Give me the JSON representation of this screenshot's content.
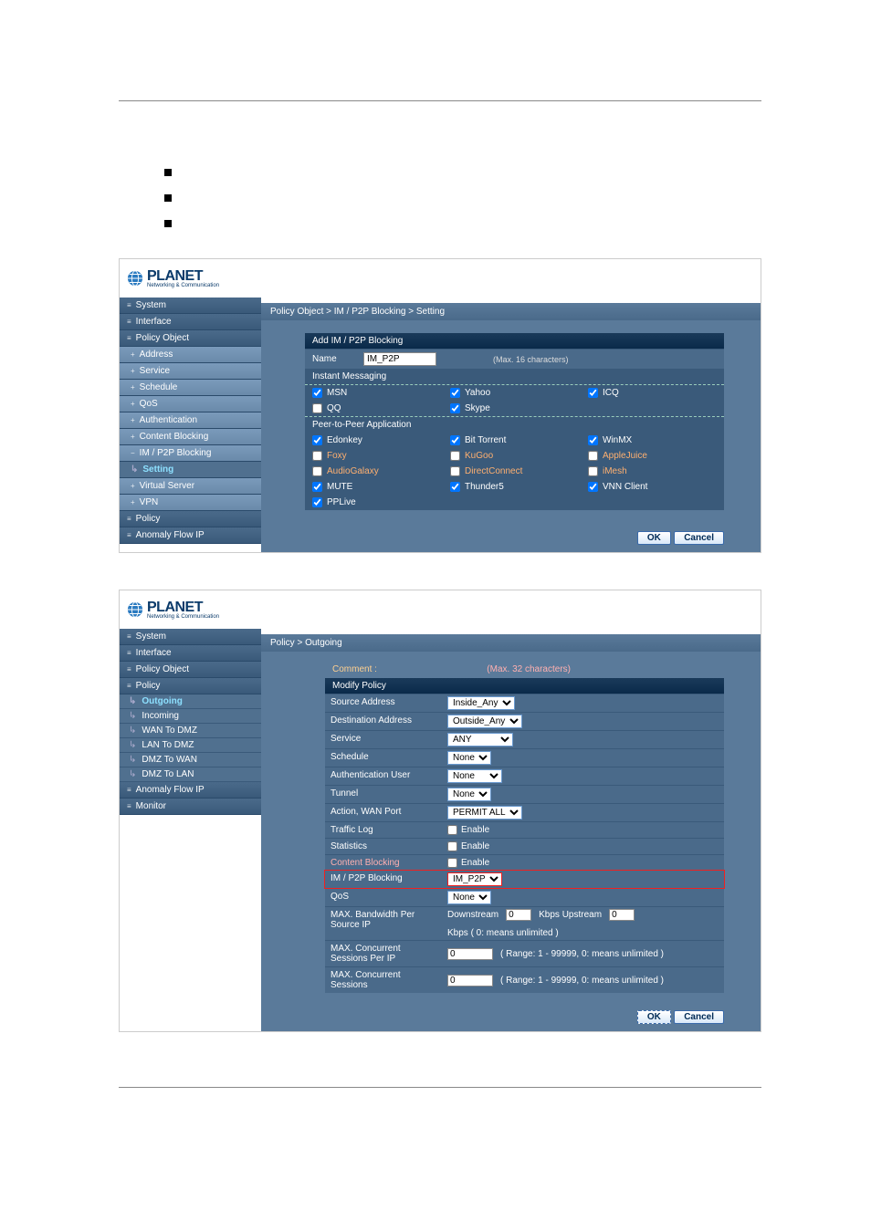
{
  "bullets": [],
  "logo": {
    "brand": "PLANET",
    "tagline": "Networking & Communication"
  },
  "shell1": {
    "breadcrumb": "Policy Object > IM / P2P Blocking > Setting",
    "nav": {
      "system": "System",
      "interface": "Interface",
      "policyObject": "Policy Object",
      "address": "Address",
      "service": "Service",
      "schedule": "Schedule",
      "qos": "QoS",
      "authentication": "Authentication",
      "contentBlocking": "Content Blocking",
      "imP2p": "IM / P2P Blocking",
      "setting": "Setting",
      "virtualServer": "Virtual Server",
      "vpn": "VPN",
      "policy": "Policy",
      "anomaly": "Anomaly Flow IP"
    },
    "panel": {
      "title": "Add IM / P2P Blocking",
      "nameLabel": "Name",
      "nameValue": "IM_P2P",
      "nameHint": "(Max. 16 characters)",
      "imSection": "Instant Messaging",
      "im": {
        "msn": "MSN",
        "yahoo": "Yahoo",
        "icq": "ICQ",
        "qq": "QQ",
        "skype": "Skype"
      },
      "p2pSection": "Peer-to-Peer Application",
      "p2p": {
        "edonkey": "Edonkey",
        "bit": "Bit Torrent",
        "winmx": "WinMX",
        "foxy": "Foxy",
        "kugoo": "KuGoo",
        "applejuice": "AppleJuice",
        "audiogalaxy": "AudioGalaxy",
        "direct": "DirectConnect",
        "imesh": "iMesh",
        "mute": "MUTE",
        "thunder5": "Thunder5",
        "vnn": "VNN Client",
        "pplive": "PPLive"
      },
      "ok": "OK",
      "cancel": "Cancel"
    }
  },
  "shell2": {
    "breadcrumb": "Policy > Outgoing",
    "nav": {
      "system": "System",
      "interface": "Interface",
      "policyObject": "Policy Object",
      "policy": "Policy",
      "outgoing": "Outgoing",
      "incoming": "Incoming",
      "wanToDmz": "WAN To DMZ",
      "lanToDmz": "LAN To DMZ",
      "dmzToWan": "DMZ To WAN",
      "dmzToLan": "DMZ To LAN",
      "anomaly": "Anomaly Flow IP",
      "monitor": "Monitor"
    },
    "form": {
      "commentLabel": "Comment :",
      "commentHint": "(Max. 32 characters)",
      "header": "Modify Policy",
      "src": {
        "label": "Source Address",
        "value": "Inside_Any"
      },
      "dst": {
        "label": "Destination Address",
        "value": "Outside_Any"
      },
      "service": {
        "label": "Service",
        "value": "ANY"
      },
      "schedule": {
        "label": "Schedule",
        "value": "None"
      },
      "auth": {
        "label": "Authentication User",
        "value": "None"
      },
      "tunnel": {
        "label": "Tunnel",
        "value": "None"
      },
      "action": {
        "label": "Action, WAN Port",
        "value": "PERMIT ALL"
      },
      "traffic": {
        "label": "Traffic Log",
        "enable": "Enable"
      },
      "stats": {
        "label": "Statistics",
        "enable": "Enable"
      },
      "cb": {
        "label": "Content Blocking",
        "enable": "Enable"
      },
      "imp2p": {
        "label": "IM / P2P Blocking",
        "value": "IM_P2P"
      },
      "qos": {
        "label": "QoS",
        "value": "None"
      },
      "bw": {
        "label": "MAX. Bandwidth Per Source IP",
        "down": "Downstream",
        "up": "Kbps Upstream",
        "tail": "Kbps ( 0: means unlimited )",
        "v": "0"
      },
      "sessip": {
        "label": "MAX. Concurrent Sessions Per IP",
        "v": "0",
        "hint": "( Range: 1 - 99999, 0: means unlimited )"
      },
      "sess": {
        "label": "MAX. Concurrent Sessions",
        "v": "0",
        "hint": "( Range: 1 - 99999, 0: means unlimited )"
      },
      "ok": "OK",
      "cancel": "Cancel"
    }
  }
}
